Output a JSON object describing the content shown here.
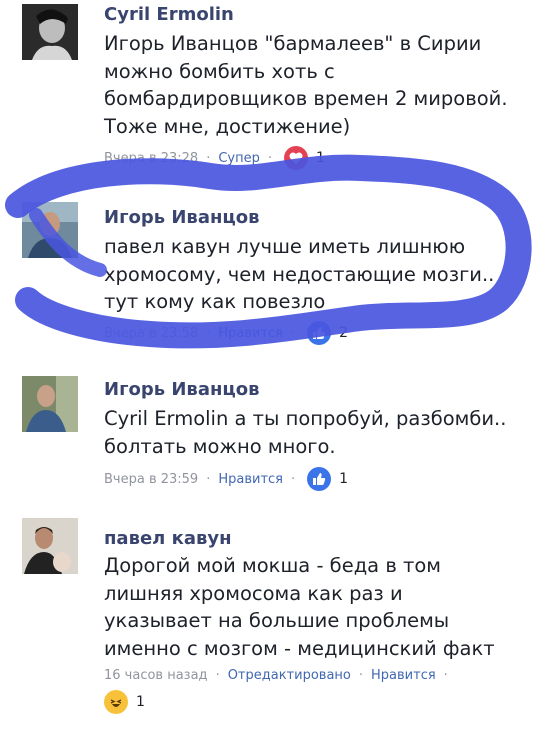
{
  "comments": [
    {
      "author": "Cyril Ermolin",
      "lines": [
        "Игорь Иванцов \"бармалеев\" в Сирии",
        "можно бомбить хоть с",
        "бомбардировщиков времен 2 мировой.",
        "Тоже мне, достижение)"
      ],
      "time": "Вчера в 23:28",
      "action": "Супер",
      "reaction_icon": "heart-icon",
      "reaction_count": "1"
    },
    {
      "author": "Игорь Иванцов",
      "lines": [
        "павел кавун лучше иметь лишнюю",
        "хромосому, чем недостающие мозги..",
        "тут кому как повезло"
      ],
      "time": "Вчера в 23:58",
      "action": "Нравится",
      "reaction_icon": "like-icon",
      "reaction_count": "2"
    },
    {
      "author": "Игорь Иванцов",
      "lines": [
        "Cyril Ermolin а ты попробуй, разбомби..",
        "болтать можно много."
      ],
      "time": "Вчера в 23:59",
      "action": "Нравится",
      "reaction_icon": "like-icon",
      "reaction_count": "1"
    },
    {
      "author": "павел кавун",
      "lines": [
        "Дорогой мой мокша - беда в том",
        "лишняя хромосома как раз и",
        "указывает на большие проблемы",
        "именно с мозгом - медицинский факт"
      ],
      "time": "16 часов назад",
      "edited": "Отредактировано",
      "action": "Нравится",
      "reaction_icon": "haha-icon",
      "reaction_count": "1"
    }
  ],
  "colors": {
    "author": "#39456e",
    "link": "#4267b2",
    "meta": "#90949c",
    "scribble": "#4a56e0"
  }
}
